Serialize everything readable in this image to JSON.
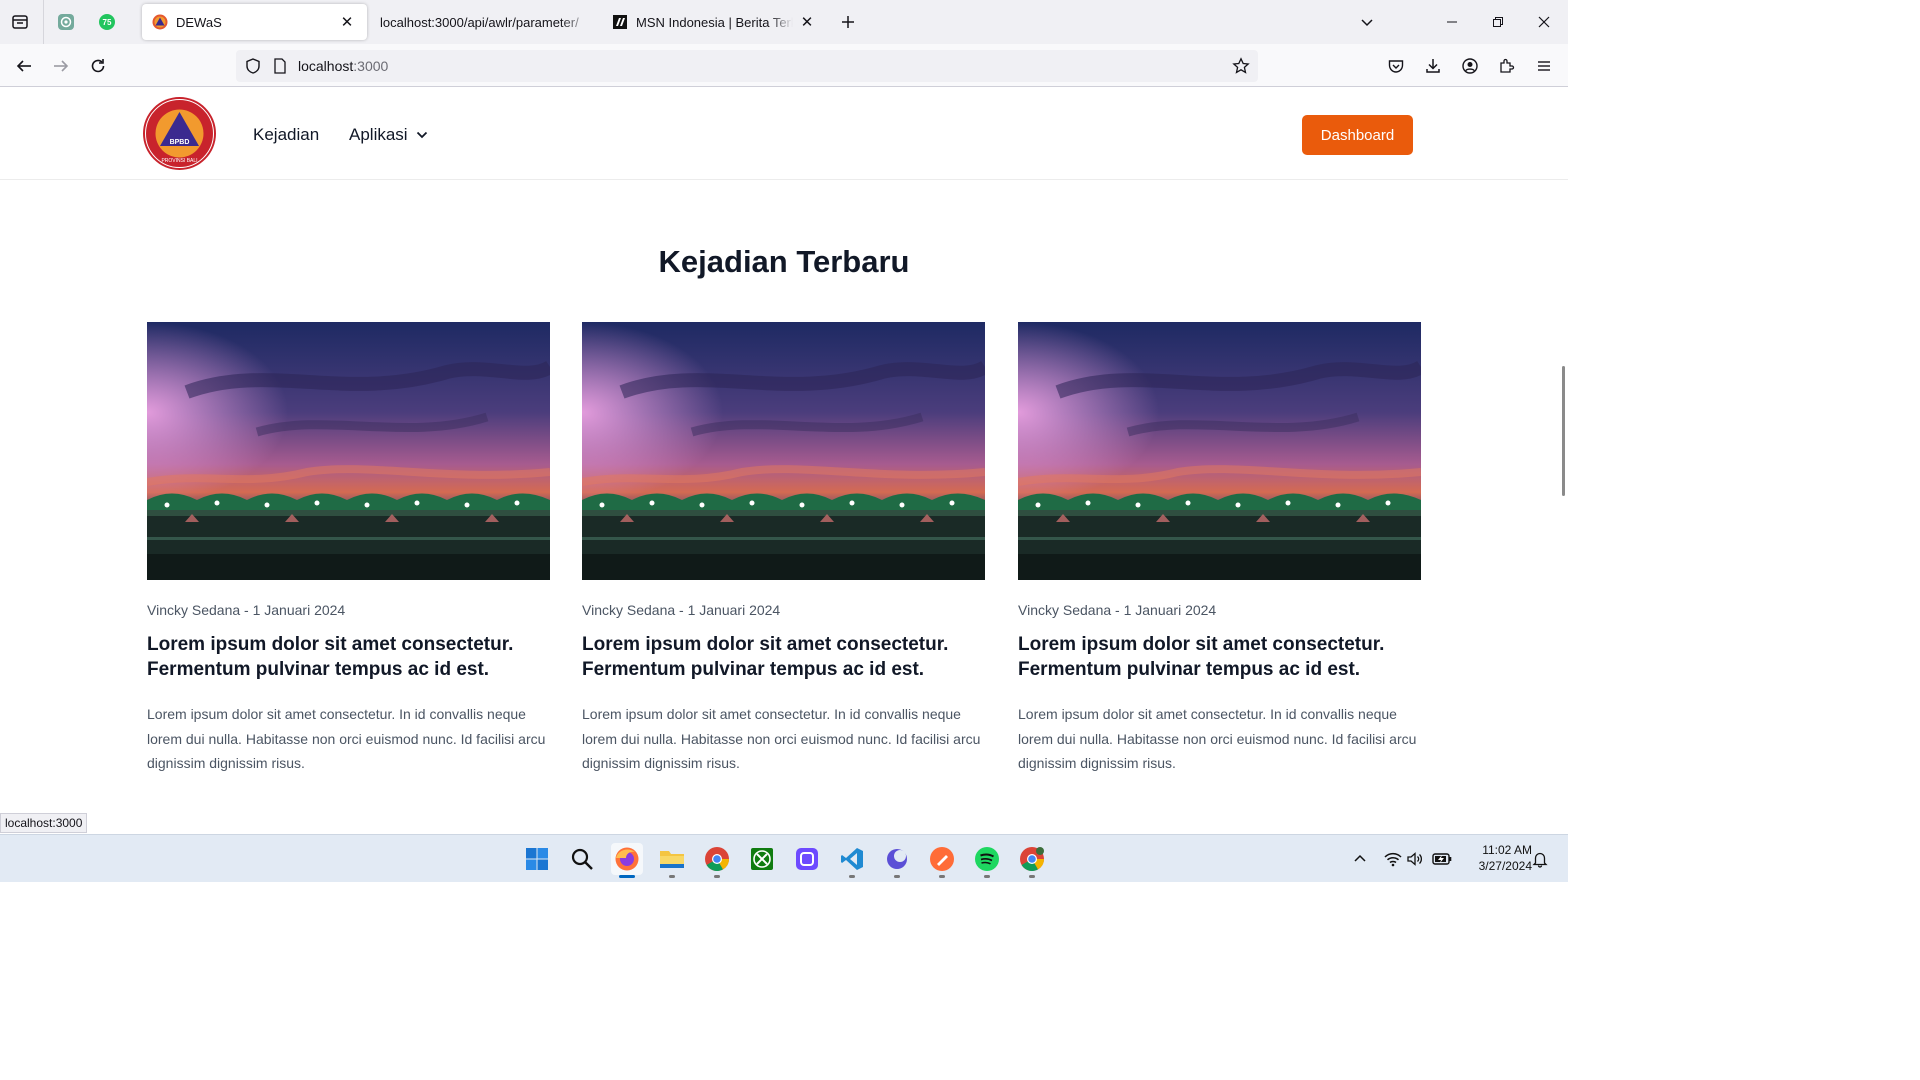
{
  "browser": {
    "tabs": [
      {
        "title": "DEWaS",
        "active": true
      },
      {
        "title": "localhost:3000/api/awlr/parameter/",
        "active": false
      },
      {
        "title": "MSN Indonesia | Berita Terkini I",
        "active": false
      }
    ],
    "pinned_badge": "75",
    "url_host": "localhost",
    "url_port": ":3000",
    "status_url": "localhost:3000"
  },
  "site": {
    "logo_text": "BPBD",
    "logo_ring_text": "BADAN PENANGGULANGAN BENCANA DAERAH",
    "logo_bottom_text": "PROVINSI BALI",
    "nav": {
      "kejadian": "Kejadian",
      "aplikasi": "Aplikasi",
      "dashboard": "Dashboard"
    },
    "section_title": "Kejadian Terbaru",
    "cards": [
      {
        "author": "Vincky Sedana",
        "date": "1 Januari 2024",
        "meta": "Vincky Sedana - 1 Januari 2024",
        "headline": "Lorem ipsum dolor sit amet consectetur. Fermentum pulvinar tempus ac id est.",
        "excerpt": "Lorem ipsum dolor sit amet consectetur. In id convallis neque lorem dui nulla. Habitasse non orci euismod nunc. Id facilisi arcu dignissim dignissim risus."
      },
      {
        "author": "Vincky Sedana",
        "date": "1 Januari 2024",
        "meta": "Vincky Sedana - 1 Januari 2024",
        "headline": "Lorem ipsum dolor sit amet consectetur. Fermentum pulvinar tempus ac id est.",
        "excerpt": "Lorem ipsum dolor sit amet consectetur. In id convallis neque lorem dui nulla. Habitasse non orci euismod nunc. Id facilisi arcu dignissim dignissim risus."
      },
      {
        "author": "Vincky Sedana",
        "date": "1 Januari 2024",
        "meta": "Vincky Sedana - 1 Januari 2024",
        "headline": "Lorem ipsum dolor sit amet consectetur. Fermentum pulvinar tempus ac id est.",
        "excerpt": "Lorem ipsum dolor sit amet consectetur. In id convallis neque lorem dui nulla. Habitasse non orci euismod nunc. Id facilisi arcu dignissim dignissim risus."
      }
    ]
  },
  "taskbar": {
    "time": "11:02 AM",
    "date": "3/27/2024",
    "apps": [
      "start-icon",
      "search-icon",
      "firefox-icon",
      "file-explorer-icon",
      "chrome-icon",
      "xbox-icon",
      "proton-vpn-icon",
      "vscode-icon",
      "app-icon",
      "postman-icon",
      "spotify-icon",
      "chrome-profile-icon"
    ]
  },
  "colors": {
    "accent": "#ea5b0c",
    "taskbar": "#e2eaf4",
    "chrome": "#f0f0f4"
  }
}
